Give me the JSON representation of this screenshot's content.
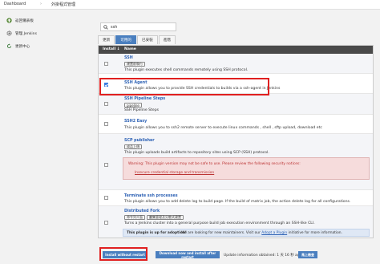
{
  "breadcrumb": {
    "root": "Dashboard",
    "separator": "›",
    "current": "外掛程式管理"
  },
  "sidebar": {
    "items": [
      {
        "label": "返回儀表板",
        "icon": "arrow-up-icon"
      },
      {
        "label": "管理 Jenkins",
        "icon": "gear-icon"
      },
      {
        "label": "更新中心",
        "icon": "refresh-icon"
      }
    ]
  },
  "search": {
    "value": "ssh",
    "placeholder": ""
  },
  "tabs": [
    {
      "label": "更新",
      "active": false
    },
    {
      "label": "可用的",
      "active": true
    },
    {
      "label": "已安裝",
      "active": false
    },
    {
      "label": "進階",
      "active": false
    }
  ],
  "table": {
    "headers": {
      "install": "Install ↓",
      "name": "Name"
    },
    "plugins": [
      {
        "name": "SSH",
        "tags": [
          "建置前執行"
        ],
        "desc": "This plugin executes shell commands remotely using SSH protocol.",
        "checked": false
      },
      {
        "name": "SSH Agent",
        "tags": [],
        "desc": "This plugin allows you to provide SSH credentials to builds via a ssh-agent in Jenkins",
        "checked": true
      },
      {
        "name": "SSH Pipeline Steps",
        "tags": [
          "pipeline"
        ],
        "desc": "SSH Pipeline Steps",
        "checked": false
      },
      {
        "name": "SSH2 Easy",
        "tags": [],
        "desc": "This plugin allows you to ssh2 remote server to execute linux commands , shell , sftp upload, download etc",
        "checked": false
      },
      {
        "name": "SCP publisher",
        "tags": [
          "成品上傳"
        ],
        "desc": "This plugin uploads build artifacts to repository sites using SCP (SSH) protocol.",
        "checked": false
      },
      {
        "name": "Terminate ssh processes",
        "tags": [],
        "desc": "This plugin allows you to add delete log to build page. If the build of matrix job, the action delete log for all configurations.",
        "checked": false
      },
      {
        "name": "Distributed Fork",
        "tags": [
          "命令列介面",
          "叢集管理及分散式建置"
        ],
        "desc": "Turns a Jenkins cluster into a general purpose build job execution environment through an SSH-like CLI.",
        "checked": false
      }
    ],
    "warning": {
      "text": "Warning: This plugin version may not be safe to use. Please review the following security notices:",
      "link": "Insecure credential storage and transmission"
    },
    "adopt": {
      "bold": "This plugin is up for adoption!",
      "before": " We are looking for new maintainers. Visit our ",
      "link": "Adopt a Plugin",
      "after": " initiative for more information."
    }
  },
  "footer": {
    "install_without_restart": "Install without restart",
    "download_restart": "Download now and install after restart",
    "update_info": "Update information obtained: 1 天 16 秒 ago",
    "check_now": "馬上檢查"
  },
  "colors": {
    "accent": "#4a7fbf",
    "highlight": "#e02020",
    "link": "#2f63b5"
  }
}
